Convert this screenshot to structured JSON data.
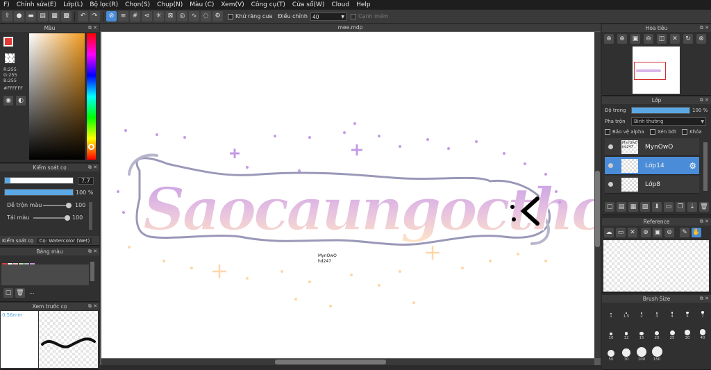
{
  "menu": [
    "F)",
    "Chỉnh sửa(E)",
    "Lớp(L)",
    "Bộ lọc(R)",
    "Chọn(S)",
    "Chụp(N)",
    "Màu (C)",
    "Xem(V)",
    "Công cụ(T)",
    "Cửa sổ(W)",
    "Cloud",
    "Help"
  ],
  "toolbar": {
    "antialias_label": "Khử răng cưa",
    "adjust_label": "Điều chỉnh",
    "adjust_value": "40",
    "edge_label": "Cạnh mềm"
  },
  "color_panel": {
    "title": "Màu",
    "r": "R:255",
    "g": "G:255",
    "b": "B:255",
    "hex": "#FFFFFF"
  },
  "brush_ctrl": {
    "title": "Kiểm soát cọ",
    "size_value": "7.7",
    "opacity_value": "100 %",
    "blend_label": "Dễ trộn màu",
    "blend_value": "100",
    "refill_label": "Tải màu",
    "refill_value": "100",
    "size_fraction": 0.08,
    "opacity_fraction": 1.0,
    "blend_fraction": 1.0,
    "refill_fraction": 1.0
  },
  "brush_tabs": {
    "tab1": "Kiểm soát cọ",
    "tab2": "Cọ: Watercolor (Wet)"
  },
  "palette": {
    "title": "Bảng màu",
    "colors": [
      "#e53935",
      "#ffffff",
      "#f8bbd0",
      "#c5e1a5",
      "#b0bec5",
      "#ce93d8"
    ],
    "more": "..."
  },
  "preview": {
    "title": "Xem trước cọ",
    "size": "0.56mm"
  },
  "document": {
    "tab": "mee.mdp",
    "signature_line1": "MynOwO",
    "signature_line2": "hd247"
  },
  "navigator": {
    "title": "Hoa tiêu"
  },
  "layers": {
    "title": "Lớp",
    "opacity_label": "Độ trong",
    "opacity_value": "100 %",
    "opacity_fraction": 1.0,
    "blend_label": "Pha trộn",
    "blend_value": "Bình thường",
    "protect_alpha": "Bảo vệ alpha",
    "clipping": "Xén bớt",
    "lock": "Khóa",
    "items": [
      {
        "name": "MynOwO",
        "thumb": "MynOwO hd247",
        "selected": false
      },
      {
        "name": "Lớp14",
        "thumb": "",
        "selected": true
      },
      {
        "name": "Lớp8",
        "thumb": "",
        "selected": false
      }
    ]
  },
  "reference": {
    "title": "Reference"
  },
  "brush_size": {
    "title": "Brush Size",
    "sizes": [
      "1",
      "1.5",
      "2",
      "3",
      "4",
      "5",
      "7",
      "10",
      "12",
      "15",
      "20",
      "25",
      "30",
      "40",
      "50",
      "70",
      "100",
      "150"
    ]
  }
}
